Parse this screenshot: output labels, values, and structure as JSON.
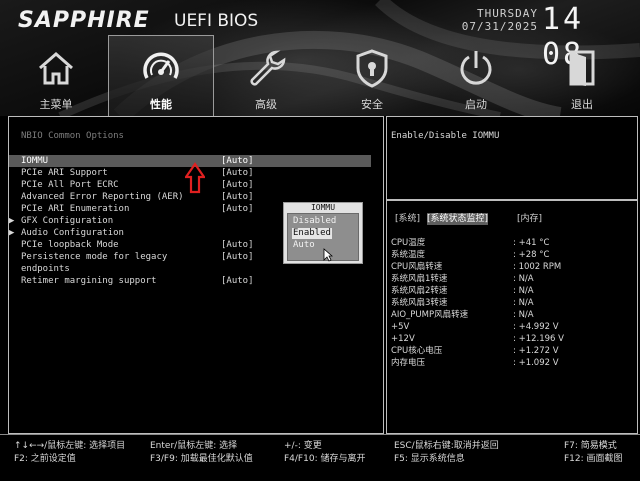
{
  "header": {
    "brand": "SAPPHIRE",
    "bios_title": "UEFI BIOS",
    "day": "THURSDAY",
    "date": "07/31/2025",
    "time": "14 08"
  },
  "tabs": [
    {
      "label": "主菜单",
      "icon": "home-icon"
    },
    {
      "label": "性能",
      "icon": "speedometer-icon",
      "active": true
    },
    {
      "label": "高级",
      "icon": "wrench-icon"
    },
    {
      "label": "安全",
      "icon": "shield-lock-icon"
    },
    {
      "label": "启动",
      "icon": "power-icon"
    },
    {
      "label": "退出",
      "icon": "exit-door-icon"
    }
  ],
  "main": {
    "section_title": "NBIO Common Options",
    "items": [
      {
        "name": "IOMMU",
        "value": "[Auto]",
        "selected": true
      },
      {
        "name": "PCIe ARI Support",
        "value": "[Auto]"
      },
      {
        "name": "PCIe All Port ECRC",
        "value": "[Auto]"
      },
      {
        "name": "Advanced Error Reporting (AER)",
        "value": "[Auto]"
      },
      {
        "name": "PCIe ARI Enumeration",
        "value": "[Auto]"
      },
      {
        "name": "GFX Configuration",
        "value": "",
        "submenu": true
      },
      {
        "name": "Audio Configuration",
        "value": "",
        "submenu": true
      },
      {
        "name": "PCIe loopback Mode",
        "value": "[Auto]"
      },
      {
        "name": "Persistence mode for legacy",
        "value": "[Auto]"
      },
      {
        "name": "endpoints",
        "value": ""
      },
      {
        "name": "Retimer margining support",
        "value": "[Auto]"
      }
    ]
  },
  "popup": {
    "title": "IOMMU",
    "options": [
      "Disabled",
      "Enabled",
      "Auto"
    ],
    "selected": "Enabled"
  },
  "help": {
    "text": "Enable/Disable IOMMU"
  },
  "hw": {
    "tabs": [
      "[系统]",
      "[系统状态监控]",
      "[内存]"
    ],
    "active_tab": "[系统状态监控]",
    "rows": [
      {
        "label": "CPU温度",
        "value": ": +41 °C"
      },
      {
        "label": "系统温度",
        "value": ": +28 °C"
      },
      {
        "label": "CPU风扇转速",
        "value": ": 1002 RPM"
      },
      {
        "label": "系统风扇1转速",
        "value": ": N/A"
      },
      {
        "label": "系统风扇2转速",
        "value": ": N/A"
      },
      {
        "label": "系统风扇3转速",
        "value": ": N/A"
      },
      {
        "label": "AIO_PUMP风扇转速",
        "value": ": N/A"
      },
      {
        "label": "+5V",
        "value": ": +4.992 V"
      },
      {
        "label": "+12V",
        "value": ": +12.196 V"
      },
      {
        "label": "CPU核心电压",
        "value": ": +1.272 V"
      },
      {
        "label": "内存电压",
        "value": ": +1.092 V"
      }
    ]
  },
  "footer": {
    "keys": [
      "↑↓←→/鼠标左键: 选择项目",
      "F2: 之前设定值",
      "Enter/鼠标左键: 选择",
      "F3/F9: 加载最佳化默认值",
      "+/-: 变更",
      "F4/F10: 储存与离开",
      "ESC/鼠标右键:取消并返回",
      "F5: 显示系统信息",
      "F7: 简易模式",
      "F12: 画面截图"
    ]
  }
}
